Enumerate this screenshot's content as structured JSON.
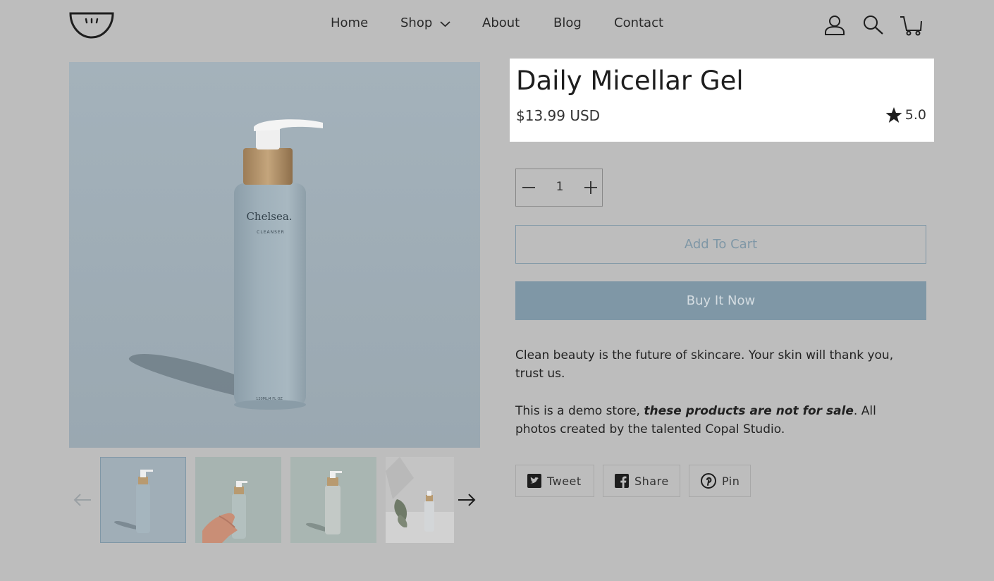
{
  "nav": {
    "home": "Home",
    "shop": "Shop",
    "about": "About",
    "blog": "Blog",
    "contact": "Contact"
  },
  "header_icons": [
    "user-account-icon",
    "search-icon",
    "cart-icon"
  ],
  "product": {
    "image_text": {
      "brand": "Chelsea.",
      "type": "CLEANSER",
      "volume": "120ML/4 FL OZ"
    },
    "title": "Daily Micellar Gel",
    "price": "$13.99 USD",
    "rating": "5.0",
    "quantity": "1",
    "add_to_cart": "Add To Cart",
    "buy_now": "Buy It Now",
    "description_1": "Clean beauty is the future of skincare. Your skin will thank you, trust us.",
    "description_2_prefix": "This is a demo store, ",
    "description_2_em": "these products are not for sale",
    "description_2_suffix": ". All photos created by the talented Copal Studio."
  },
  "share": {
    "tweet": "Tweet",
    "share": "Share",
    "pin": "Pin"
  },
  "colors": {
    "overlay_bg": "#bdbdbd",
    "accent": "#7f97a6",
    "title_box": "#ffffff"
  }
}
